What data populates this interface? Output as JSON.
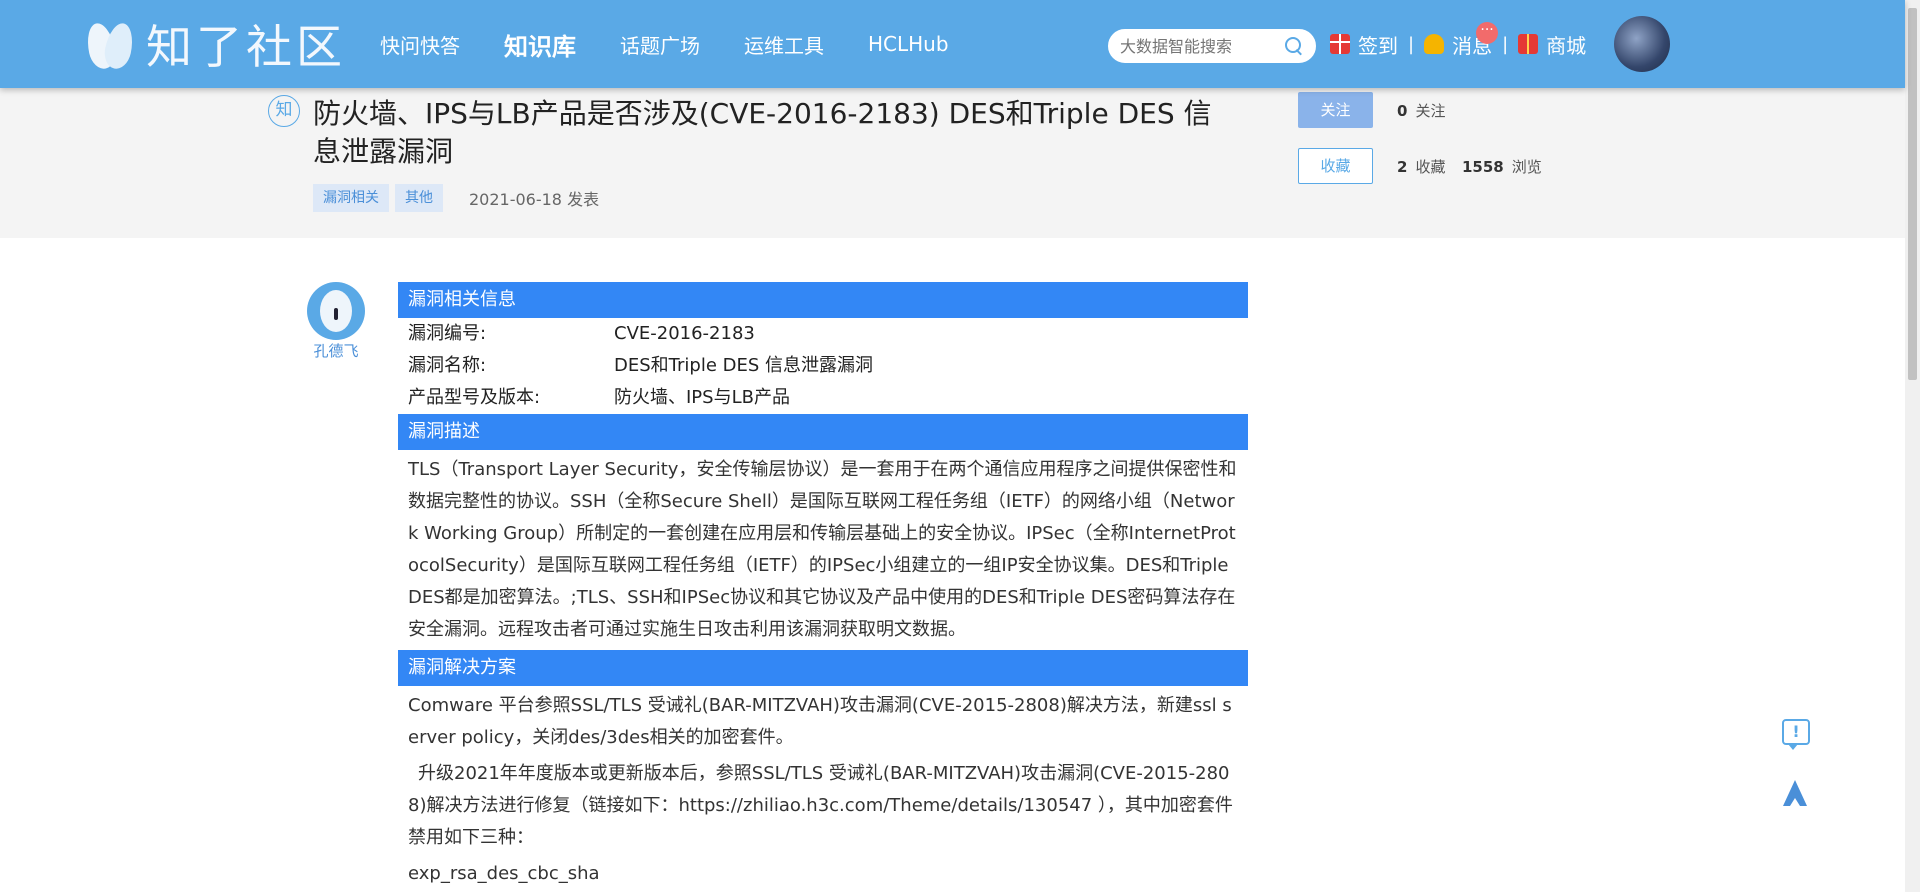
{
  "header": {
    "logo_text": "知了社区",
    "nav": [
      "快问快答",
      "知识库",
      "话题广场",
      "运维工具",
      "HCLHub"
    ],
    "search_placeholder": "大数据智能搜索",
    "checkin": "签到",
    "messages": "消息",
    "messages_badge": "···",
    "mall": "商城",
    "separator": "|"
  },
  "title_area": {
    "icon_label": "知",
    "title": "防火墙、IPS与LB产品是否涉及(CVE-2016-2183) DES和Triple DES 信息泄露漏洞",
    "tags": [
      "漏洞相关",
      "其他"
    ],
    "date": "2021-06-18 发表",
    "follow_button": "关注",
    "favorite_button": "收藏",
    "follow_count": "0",
    "follow_label": "关注",
    "favorite_count": "2",
    "favorite_label": "收藏",
    "view_count": "1558",
    "view_label": "浏览"
  },
  "author": {
    "name": "孔德飞"
  },
  "content": {
    "section1_title": "漏洞相关信息",
    "info_rows": [
      {
        "key": "漏洞编号:",
        "value": "CVE-2016-2183"
      },
      {
        "key": "漏洞名称:",
        "value": "DES和Triple DES 信息泄露漏洞"
      },
      {
        "key": "产品型号及版本:",
        "value": "防火墙、IPS与LB产品"
      }
    ],
    "section2_title": "漏洞描述",
    "description": "TLS（Transport Layer Security，安全传输层协议）是一套用于在两个通信应用程序之间提供保密性和数据完整性的协议。SSH（全称Secure Shell）是国际互联网工程任务组（IETF）的网络小组（Network Working Group）所制定的一套创建在应用层和传输层基础上的安全协议。IPSec（全称InternetProtocolSecurity）是国际互联网工程任务组（IETF）的IPSec小组建立的一组IP安全协议集。DES和Triple DES都是加密算法。;TLS、SSH和IPSec协议和其它协议及产品中使用的DES和Triple DES密码算法存在安全漏洞。远程攻击者可通过实施生日攻击利用该漏洞获取明文数据。",
    "section3_title": "漏洞解决方案",
    "solution_p1": "Comware 平台参照SSL/TLS 受诫礼(BAR-MITZVAH)攻击漏洞(CVE-2015-2808)解决方法，新建ssl server policy，关闭des/3des相关的加密套件。",
    "solution_p2": "升级2021年年度版本或更新版本后，参照SSL/TLS 受诫礼(BAR-MITZVAH)攻击漏洞(CVE-2015-2808)解决方法进行修复（链接如下：https://zhiliao.h3c.com/Theme/details/130547 ），其中加密套件禁用如下三种：",
    "solution_p3": "exp_rsa_des_cbc_sha"
  },
  "colors": {
    "header": "#5aa9e6",
    "section_head": "#3387f5",
    "tag_bg": "#dde8f7"
  }
}
